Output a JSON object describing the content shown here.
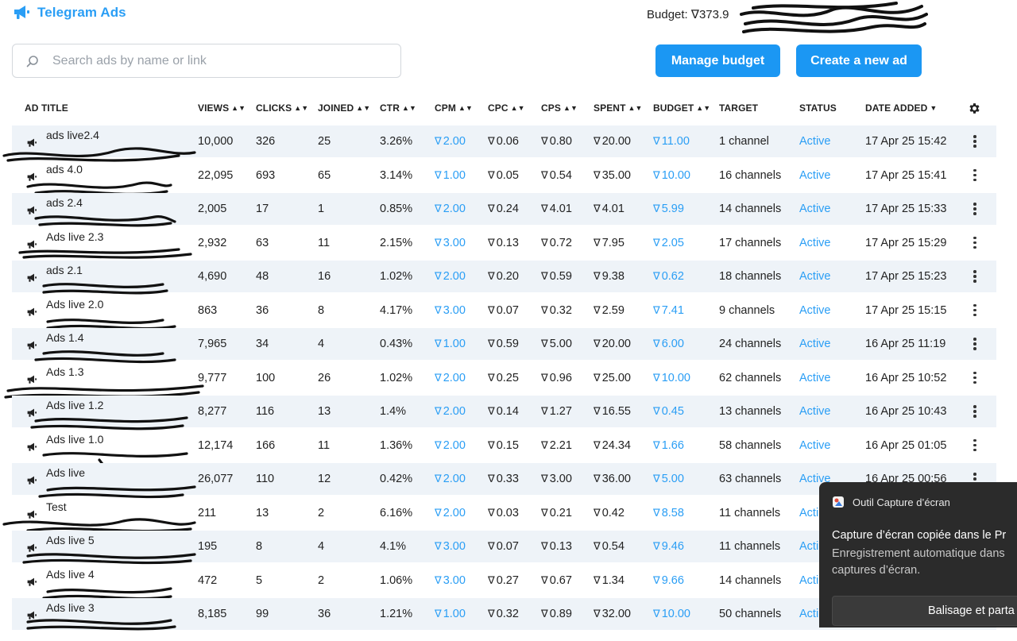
{
  "header": {
    "app_name": "Telegram Ads",
    "budget_label": "Budget:",
    "budget_symbol": "∇",
    "budget_value": "373.9"
  },
  "search": {
    "placeholder": "Search ads by name or link"
  },
  "buttons": {
    "manage_budget": "Manage budget",
    "create_ad": "Create a new ad"
  },
  "ton_symbol": "∇",
  "columns": {
    "title": "AD TITLE",
    "views": "VIEWS",
    "clicks": "CLICKS",
    "joined": "JOINED",
    "ctr": "CTR",
    "cpm": "CPM",
    "cpc": "CPC",
    "cps": "CPS",
    "spent": "SPENT",
    "budget": "BUDGET",
    "target": "TARGET",
    "status": "STATUS",
    "date": "DATE ADDED"
  },
  "rows": [
    {
      "title": "ads live2.4",
      "views": "10,000",
      "clicks": "326",
      "joined": "25",
      "ctr": "3.26%",
      "cpm": "2.00",
      "cpc": "0.06",
      "cps": "0.80",
      "spent": "20.00",
      "budget": "11.00",
      "target": "1 channel",
      "status": "Active",
      "date": "17 Apr 25 15:42"
    },
    {
      "title": "ads 4.0",
      "views": "22,095",
      "clicks": "693",
      "joined": "65",
      "ctr": "3.14%",
      "cpm": "1.00",
      "cpc": "0.05",
      "cps": "0.54",
      "spent": "35.00",
      "budget": "10.00",
      "target": "16 channels",
      "status": "Active",
      "date": "17 Apr 25 15:41"
    },
    {
      "title": "ads 2.4",
      "views": "2,005",
      "clicks": "17",
      "joined": "1",
      "ctr": "0.85%",
      "cpm": "2.00",
      "cpc": "0.24",
      "cps": "4.01",
      "spent": "4.01",
      "budget": "5.99",
      "target": "14 channels",
      "status": "Active",
      "date": "17 Apr 25 15:33"
    },
    {
      "title": "Ads live 2.3",
      "views": "2,932",
      "clicks": "63",
      "joined": "11",
      "ctr": "2.15%",
      "cpm": "3.00",
      "cpc": "0.13",
      "cps": "0.72",
      "spent": "7.95",
      "budget": "2.05",
      "target": "17 channels",
      "status": "Active",
      "date": "17 Apr 25 15:29"
    },
    {
      "title": "ads 2.1",
      "views": "4,690",
      "clicks": "48",
      "joined": "16",
      "ctr": "1.02%",
      "cpm": "2.00",
      "cpc": "0.20",
      "cps": "0.59",
      "spent": "9.38",
      "budget": "0.62",
      "target": "18 channels",
      "status": "Active",
      "date": "17 Apr 25 15:23"
    },
    {
      "title": "Ads live 2.0",
      "views": "863",
      "clicks": "36",
      "joined": "8",
      "ctr": "4.17%",
      "cpm": "3.00",
      "cpc": "0.07",
      "cps": "0.32",
      "spent": "2.59",
      "budget": "7.41",
      "target": "9 channels",
      "status": "Active",
      "date": "17 Apr 25 15:15"
    },
    {
      "title": "Ads 1.4",
      "views": "7,965",
      "clicks": "34",
      "joined": "4",
      "ctr": "0.43%",
      "cpm": "1.00",
      "cpc": "0.59",
      "cps": "5.00",
      "spent": "20.00",
      "budget": "6.00",
      "target": "24 channels",
      "status": "Active",
      "date": "16 Apr 25 11:19"
    },
    {
      "title": "Ads 1.3",
      "views": "9,777",
      "clicks": "100",
      "joined": "26",
      "ctr": "1.02%",
      "cpm": "2.00",
      "cpc": "0.25",
      "cps": "0.96",
      "spent": "25.00",
      "budget": "10.00",
      "target": "62 channels",
      "status": "Active",
      "date": "16 Apr 25 10:52"
    },
    {
      "title": "Ads live 1.2",
      "views": "8,277",
      "clicks": "116",
      "joined": "13",
      "ctr": "1.4%",
      "cpm": "2.00",
      "cpc": "0.14",
      "cps": "1.27",
      "spent": "16.55",
      "budget": "0.45",
      "target": "13 channels",
      "status": "Active",
      "date": "16 Apr 25 10:43"
    },
    {
      "title": "Ads live 1.0",
      "views": "12,174",
      "clicks": "166",
      "joined": "11",
      "ctr": "1.36%",
      "cpm": "2.00",
      "cpc": "0.15",
      "cps": "2.21",
      "spent": "24.34",
      "budget": "1.66",
      "target": "58 channels",
      "status": "Active",
      "date": "16 Apr 25 01:05"
    },
    {
      "title": "Ads live",
      "views": "26,077",
      "clicks": "110",
      "joined": "12",
      "ctr": "0.42%",
      "cpm": "2.00",
      "cpc": "0.33",
      "cps": "3.00",
      "spent": "36.00",
      "budget": "5.00",
      "target": "63 channels",
      "status": "Active",
      "date": "16 Apr 25 00:56"
    },
    {
      "title": "Test",
      "views": "211",
      "clicks": "13",
      "joined": "2",
      "ctr": "6.16%",
      "cpm": "2.00",
      "cpc": "0.03",
      "cps": "0.21",
      "spent": "0.42",
      "budget": "8.58",
      "target": "11 channels",
      "status": "Acti",
      "date": ""
    },
    {
      "title": "Ads live 5",
      "views": "195",
      "clicks": "8",
      "joined": "4",
      "ctr": "4.1%",
      "cpm": "3.00",
      "cpc": "0.07",
      "cps": "0.13",
      "spent": "0.54",
      "budget": "9.46",
      "target": "11 channels",
      "status": "Acti",
      "date": ""
    },
    {
      "title": "Ads live 4",
      "views": "472",
      "clicks": "5",
      "joined": "2",
      "ctr": "1.06%",
      "cpm": "3.00",
      "cpc": "0.27",
      "cps": "0.67",
      "spent": "1.34",
      "budget": "9.66",
      "target": "14 channels",
      "status": "Acti",
      "date": ""
    },
    {
      "title": "Ads live 3",
      "views": "8,185",
      "clicks": "99",
      "joined": "36",
      "ctr": "1.21%",
      "cpm": "1.00",
      "cpc": "0.32",
      "cps": "0.89",
      "spent": "32.00",
      "budget": "10.00",
      "target": "50 channels",
      "status": "Acti",
      "date": ""
    }
  ],
  "toast": {
    "app_name": "Outil Capture d’écran",
    "message": "Capture d’écran copiée dans le Pr",
    "detail_line1": "Enregistrement automatique dans",
    "detail_line2": "captures d’écran.",
    "button": "Balisage et parta"
  },
  "colors": {
    "accent": "#1b97f3",
    "link": "#2a9ef5",
    "row_alt": "#eef3f8",
    "toast_bg": "#2b2b2b"
  }
}
